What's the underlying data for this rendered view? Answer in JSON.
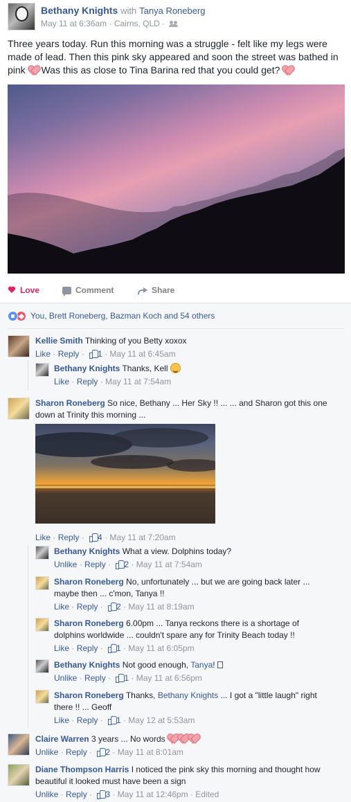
{
  "post": {
    "author": "Bethany Knights",
    "with_text": "with",
    "tagged": "Tanya Roneberg",
    "meta": "May 11 at 6:36am · Cairns, QLD ·",
    "text_before_emoji": "Three years today. Run this morning was a struggle - felt like my legs were made of lead. Then this pink sky appeared and soon the street was bathed in pink",
    "text_after_emoji": " Was this as close to Tina Barina red that you could get? "
  },
  "actions": {
    "love": "Love",
    "comment": "Comment",
    "share": "Share"
  },
  "reactions": {
    "summary": "You, Brett Roneberg, Bazman Koch and 54 others"
  },
  "comments": [
    {
      "author": "Kellie Smith",
      "text": "Thinking of you Betty xoxox",
      "like": "Like",
      "reply": "Reply",
      "likes": "1",
      "time": "May 11 at 6:45am",
      "replies": [
        {
          "author": "Bethany Knights",
          "text": "Thanks, Kell ",
          "like": "Like",
          "reply": "Reply",
          "time": "May 11 at 7:54am"
        }
      ]
    },
    {
      "author": "Sharon Roneberg",
      "text": "So nice, Bethany ... Her Sky !! ... ... and Sharon got this one down at Trinity this morning ...",
      "like": "Like",
      "reply": "Reply",
      "likes": "4",
      "time": "May 11 at 7:20am",
      "replies": [
        {
          "author": "Bethany Knights",
          "text": "What a view. Dolphins today?",
          "like": "Unlike",
          "reply": "Reply",
          "likes": "2",
          "time": "May 11 at 7:54am"
        },
        {
          "author": "Sharon Roneberg",
          "text": "No, unfortunately ... but we are going back later ... maybe then ... c'mon, Tanya !!",
          "like": "Like",
          "reply": "Reply",
          "likes": "2",
          "time": "May 11 at 8:19am"
        },
        {
          "author": "Sharon Roneberg",
          "text": "6.00pm ... Tanya reckons there is a shortage of dolphins worldwide ... couldn't spare any for Trinity Beach today !!",
          "like": "Like",
          "reply": "Reply",
          "likes": "1",
          "time": "May 11 at 6:05pm"
        },
        {
          "author": "Bethany Knights",
          "text_before": "Not good enough, ",
          "mention": "Tanya",
          "text_after": "! ",
          "like": "Unlike",
          "reply": "Reply",
          "likes": "1",
          "time": "May 11 at 6:56pm"
        },
        {
          "author": "Sharon Roneberg",
          "text_before": "Thanks, ",
          "mention": "Bethany Knights",
          "text_after": " ... I got a \"little laugh\" right there !! ... Geoff",
          "like": "Like",
          "reply": "Reply",
          "likes": "1",
          "time": "May 12 at 5:53am"
        }
      ]
    },
    {
      "author": "Claire Warren",
      "text": "3 years ... No words ",
      "like": "Unlike",
      "reply": "Reply",
      "likes": "2",
      "time": "May 11 at 8:01am"
    },
    {
      "author": "Diane Thompson Harris",
      "text": "I noticed the pink sky this morning and thought how beautiful it looked must have been a sign",
      "like": "Unlike",
      "reply": "Reply",
      "likes": "3",
      "time": "May 11 at 12:46pm · Edited"
    }
  ],
  "colors": {
    "link": "#365899",
    "love": "#e0245e",
    "meta": "#90949c",
    "feedback_bg": "#f6f7f9"
  }
}
